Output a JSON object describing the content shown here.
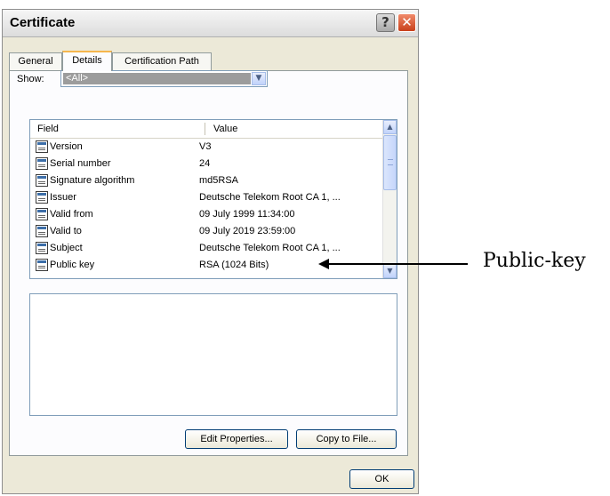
{
  "dialog": {
    "title": "Certificate",
    "help_glyph": "?",
    "close_glyph": "✕"
  },
  "tabs": [
    {
      "label": "General",
      "active": false
    },
    {
      "label": "Details",
      "active": true
    },
    {
      "label": "Certification Path",
      "active": false
    }
  ],
  "show": {
    "label": "Show:",
    "selected": "<All>"
  },
  "list": {
    "columns": {
      "field": "Field",
      "value": "Value"
    },
    "rows": [
      {
        "field": "Version",
        "value": "V3"
      },
      {
        "field": "Serial number",
        "value": "24"
      },
      {
        "field": "Signature algorithm",
        "value": "md5RSA"
      },
      {
        "field": "Issuer",
        "value": "Deutsche Telekom Root CA 1, ..."
      },
      {
        "field": "Valid from",
        "value": "09 July 1999 11:34:00"
      },
      {
        "field": "Valid to",
        "value": "09 July 2019 23:59:00"
      },
      {
        "field": "Subject",
        "value": "Deutsche Telekom Root CA 1, ..."
      },
      {
        "field": "Public key",
        "value": "RSA (1024 Bits)"
      }
    ]
  },
  "buttons": {
    "edit_properties": "Edit Properties...",
    "copy_to_file": "Copy to File...",
    "ok": "OK"
  },
  "annotation": {
    "label": "Public-key"
  },
  "colors": {
    "dialog_bg": "#ece9d8",
    "close_button": "#c8401b",
    "active_tab_highlight": "#f6b64d",
    "field_border": "#7f9db9"
  }
}
